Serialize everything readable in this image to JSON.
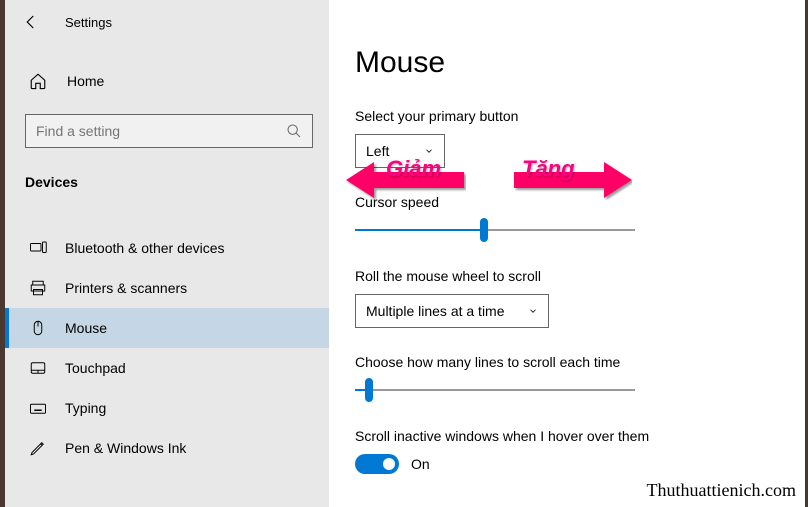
{
  "app": {
    "title": "Settings"
  },
  "sidebar": {
    "home": "Home",
    "search_placeholder": "Find a setting",
    "section": "Devices",
    "items": [
      {
        "label": "Bluetooth & other devices"
      },
      {
        "label": "Printers & scanners"
      },
      {
        "label": "Mouse"
      },
      {
        "label": "Touchpad"
      },
      {
        "label": "Typing"
      },
      {
        "label": "Pen & Windows Ink"
      }
    ]
  },
  "page": {
    "title": "Mouse",
    "primary_label": "Select your primary button",
    "primary_value": "Left",
    "cursor_speed_label": "Cursor speed",
    "cursor_speed_pct": 46,
    "scroll_label": "Roll the mouse wheel to scroll",
    "scroll_value": "Multiple lines at a time",
    "lines_label": "Choose how many lines to scroll each time",
    "lines_pct": 5,
    "inactive_label": "Scroll inactive windows when I hover over them",
    "toggle_on": "On"
  },
  "annotations": {
    "decrease": "Giảm",
    "increase": "Tăng"
  },
  "watermark": "Thuthuattienich.com"
}
